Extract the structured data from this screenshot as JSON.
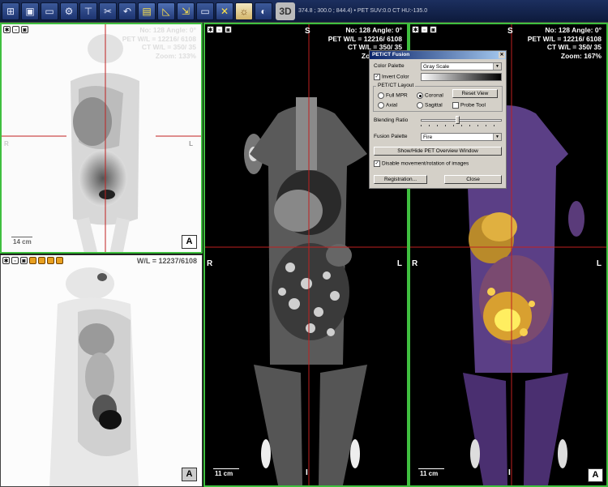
{
  "toolbar": {
    "buttons": [
      "layout-icon",
      "save-icon",
      "comment-icon",
      "settings-icon",
      "screw-icon",
      "tools-icon",
      "undo-icon",
      "window-level-icon",
      "measure-icon",
      "export-icon",
      "monitor-icon",
      "close-icon",
      "fusion-icon",
      "contrast-icon"
    ],
    "label_3d": "3D",
    "status": "374.8 ; 300.0 ; 844.4) • PET SUV:0.0 CT HU:-135.0"
  },
  "panels": {
    "tl": {
      "info": [
        "No: 128   Angle: 0°",
        "PET W/L = 12216/ 6108",
        "CT W/L = 350/ 35",
        "Zoom: 133%"
      ],
      "left_label": "R",
      "right_label": "L",
      "scale": "14 cm",
      "corner": "A"
    },
    "bl": {
      "info": "W/L = 12237/6108",
      "corner": "A"
    },
    "center": {
      "info": [
        "No: 128   Angle: 0°",
        "PET W/L = 12216/ 6108",
        "CT W/L = 350/ 35",
        "Zoom: 167%"
      ],
      "top": "S",
      "left": "R",
      "right": "L",
      "bottom": "I",
      "scale": "11 cm"
    },
    "right": {
      "info": [
        "No: 128   Angle: 0°",
        "PET W/L = 12216/ 6108",
        "CT W/L = 350/ 35",
        "Zoom: 167%"
      ],
      "top": "S",
      "left": "R",
      "right": "L",
      "bottom": "I",
      "scale": "11 cm",
      "corner": "A"
    }
  },
  "dialog": {
    "title": "PET/CT Fusion",
    "color_palette_label": "Color Palette",
    "color_palette_value": "Gray Scale",
    "invert_color_label": "Invert Color",
    "layout_group": "PET/CT Layout",
    "full_mpr": "Full MPR",
    "coronal": "Coronal",
    "reset_view": "Reset View",
    "axial": "Axial",
    "sagittal": "Sagittal",
    "probe_tool": "Probe Tool",
    "blending_label": "Blending Ratio",
    "blending_ratio": 0.45,
    "fusion_palette_label": "Fusion Palette",
    "fusion_palette_value": "Fire",
    "show_hide_button": "Show/Hide PET Overview Window",
    "disable_label": "Disable movement/rotation of images",
    "registration_button": "Registration...",
    "close_button": "Close"
  },
  "colors": {
    "active_border": "#3fbf3f",
    "crosshair": "#c02020",
    "toolbar": "#142650"
  }
}
